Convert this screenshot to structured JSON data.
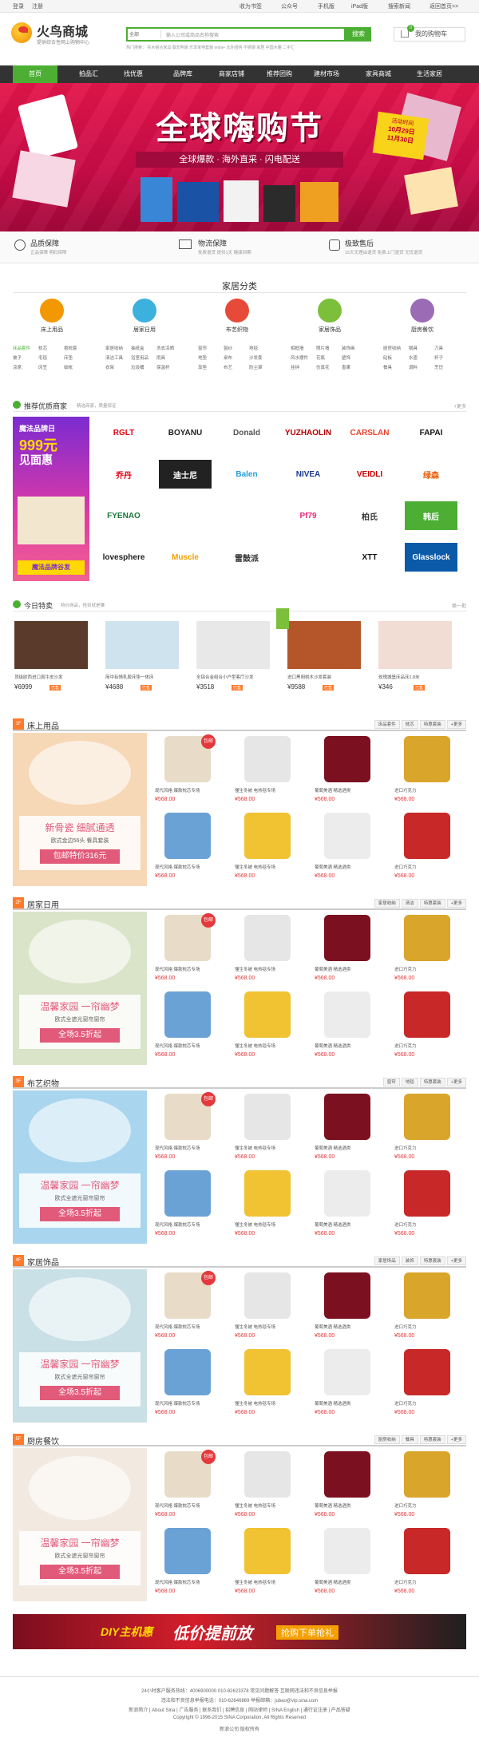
{
  "topbar": {
    "login": "登录",
    "register": "注册",
    "fav": "收为书签",
    "wechat": "公众号",
    "mobile": "手机版",
    "ipad": "iPad版",
    "news": "搜索新闻",
    "back": "返回首页>>"
  },
  "logo": {
    "name": "火鸟商城",
    "slogan": "提供综合性网上购物中心"
  },
  "search": {
    "select": "全部",
    "placeholder": "输入公司或商品名称搜索",
    "button": "搜索",
    "hot": "热门搜索：  实木组合家具  蔡宏明家  乐享家电套装  tesla+  北外团购  不锈钢  家居  中国木雕  二手汇"
  },
  "cart": {
    "label": "我的购物车",
    "count": "0"
  },
  "nav": [
    "首页",
    "拍品汇",
    "找优惠",
    "品牌库",
    "商家店铺",
    "推荐团购",
    "建材市场",
    "家具商城",
    "生活家居"
  ],
  "banner": {
    "title": "全球嗨购节",
    "subtitle": "全球爆款 · 海外直采 · 闪电配送",
    "date1": "活动时间",
    "date2": "10月29日",
    "date3": "11月30日"
  },
  "guarantee": [
    {
      "title": "品质保障",
      "sub": "正品保障  明码保障"
    },
    {
      "title": "物流保障",
      "sub": "免费退货 提供1天  健康到期"
    },
    {
      "title": "极致售后",
      "sub": "15天无理由退货 免费上门退货 无忧退货"
    }
  ],
  "categories": {
    "title": "家居分类",
    "items": [
      {
        "name": "床上用品",
        "links": [
          "床品套件",
          "枕芯",
          "抱枕套",
          "被子",
          "毛毯",
          "床垫",
          "凉席",
          "床笠",
          "蚊帐"
        ],
        "color": "#f39800"
      },
      {
        "name": "居家日用",
        "links": [
          "家居收纳",
          "抽纸盒",
          "洗衣凉晒",
          "清洁工具",
          "浴室用品",
          "雨具",
          "衣架",
          "垃圾桶",
          "保温杯"
        ],
        "color": "#3db1de"
      },
      {
        "name": "布艺织物",
        "links": [
          "窗帘",
          "窗纱",
          "地毯",
          "地垫",
          "桌布",
          "沙发套",
          "靠垫",
          "布艺",
          "防尘罩"
        ],
        "color": "#e84a3a"
      },
      {
        "name": "家居饰品",
        "links": [
          "相框墙",
          "照片墙",
          "装饰画",
          "风水摆件",
          "花瓶",
          "壁饰",
          "挂钟",
          "仿真花",
          "香薰"
        ],
        "color": "#7cbf3b"
      },
      {
        "name": "厨房餐饮",
        "links": [
          "厨房收纳",
          "锅具",
          "刀具",
          "砧板",
          "水壶",
          "杯子",
          "餐具",
          "调料",
          "烹饪"
        ],
        "color": "#9b6bb5"
      }
    ]
  },
  "merchants": {
    "title": "推荐优质商家",
    "subtitle": "精选商家，质量保证",
    "more": "+更多",
    "promo1": "魔法品牌日",
    "promo2": "999元",
    "promo3": "见面惠",
    "promo4": "魔法品牌谷发",
    "brands": [
      "RGLT",
      "BOYANU",
      "Donald",
      "YUZHAOLIN",
      "CARSLAN",
      "FAPAI",
      "乔丹",
      "迪士尼",
      "Balen",
      "NIVEA",
      "VEIDLI",
      "绿森",
      "FYENAO",
      "",
      "",
      "Pf79",
      "柏氏",
      "韩后",
      "lovesphere",
      "Muscle",
      "雷鼓派",
      "",
      "XTT",
      "Glasslock"
    ]
  },
  "deals": {
    "title": "今日特卖",
    "subtitle": "特价商品，抢到就是赚",
    "more": "换一批",
    "items": [
      {
        "title": "顶级欧西进口真牛皮沙发",
        "price": "¥6999",
        "sold": "已售"
      },
      {
        "title": "简中有情乳胶床垫一体床",
        "price": "¥4688",
        "sold": "已售"
      },
      {
        "title": "全铝合金组合小户型客厅沙发",
        "price": "¥3518",
        "sold": "已售"
      },
      {
        "title": "进口黑胡桃木沙发套装",
        "price": "¥9588",
        "sold": "已售"
      },
      {
        "title": "玫瑰城堡床品床1.8米",
        "price": "¥346",
        "sold": "已售"
      }
    ]
  },
  "floors": [
    {
      "badge": "1F",
      "title": "床上用品",
      "tabs": [
        "床品套件",
        "枕芯",
        "特惠套装",
        "+更多"
      ],
      "promo": [
        "新骨瓷 细腻通透",
        "欧式金边56头 餐具套装",
        "包邮特价316元"
      ]
    },
    {
      "badge": "2F",
      "title": "居家日用",
      "tabs": [
        "家居收纳",
        "清洁",
        "特惠套装",
        "+更多"
      ],
      "promo": [
        "温馨家园 一帘幽梦",
        "欧式全遮光窗帘窗帘",
        "全场3.5折起"
      ]
    },
    {
      "badge": "3F",
      "title": "布艺织物",
      "tabs": [
        "窗帘",
        "地毯",
        "特惠套装",
        "+更多"
      ],
      "promo": [
        "温馨家园 一帘幽梦",
        "欧式全遮光窗帘窗帘",
        "全场3.5折起"
      ]
    },
    {
      "badge": "4F",
      "title": "家居饰品",
      "tabs": [
        "家居饰品",
        "装饰",
        "特惠套装",
        "+更多"
      ],
      "promo": [
        "温馨家园 一帘幽梦",
        "欧式全遮光窗帘窗帘",
        "全场3.5折起"
      ]
    },
    {
      "badge": "5F",
      "title": "厨房餐饮",
      "tabs": [
        "厨房收纳",
        "餐具",
        "特惠套装",
        "+更多"
      ],
      "promo": [
        "温馨家园 一帘幽梦",
        "欧式全遮光窗帘窗帘",
        "全场3.5折起"
      ]
    }
  ],
  "products": [
    {
      "title": "现代风格 爆款枕芯专场",
      "price": "¥568.00"
    },
    {
      "title": "懂生冬被 电热毯专场",
      "price": "¥568.00"
    },
    {
      "title": "葡萄美酒 精选酒类",
      "price": "¥568.00"
    },
    {
      "title": "进口巧克力",
      "price": "¥568.00"
    },
    {
      "title": "现代风格 爆款枕芯专场",
      "price": "¥568.00"
    },
    {
      "title": "懂生冬被 电热毯专场",
      "price": "¥568.00"
    },
    {
      "title": "葡萄美酒 精选酒类",
      "price": "¥568.00"
    },
    {
      "title": "进口巧克力",
      "price": "¥568.00"
    }
  ],
  "badge_baoyou": "包邮",
  "bottom_banner": {
    "text1": "DIY主机惠",
    "text2": "低价提前放",
    "text3": "抢购下单抢礼"
  },
  "footer": {
    "l1": "24小时客户服务热线：4006900000 010-82623378 常见问题解答 互联网违法和不良信息举报",
    "l2": "违法和不良信息举报电话：010-62646869 举报邮箱：jubao@vip.sina.com",
    "l3": "新浪简介 | About Sina | 广告服务 | 联系我们 | 招聘信息 | 网站律师 | SINA English | 通行证注册 | 产品答疑",
    "l4": "Copyright © 1996-2015 SINA Corporation, All Rights Reserved",
    "l5": "新浪公司 版权所有"
  }
}
